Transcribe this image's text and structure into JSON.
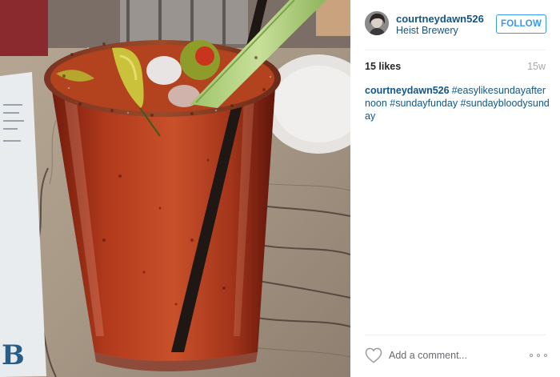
{
  "post": {
    "username": "courtneydawn526",
    "location": "Heist Brewery",
    "follow_label": "FOLLOW",
    "likes": "15 likes",
    "time_ago": "15w",
    "caption_user": "courtneydawn526",
    "caption_text": "#easylikesundayafternoon #sundayfunday #sundaybloodysunday",
    "comment_placeholder": "Add a comment..."
  },
  "photo": {
    "subject": "bloody mary cocktail with celery, straw, olives and peppers on a wooden table",
    "menu_letter": "B"
  },
  "colors": {
    "link": "#125688",
    "follow_blue": "#3897f0",
    "text_dark": "#262626",
    "text_muted": "#a5a7aa",
    "divider": "#efefef"
  },
  "icons": {
    "like": "heart-outline-icon",
    "more": "more-options-icon"
  }
}
